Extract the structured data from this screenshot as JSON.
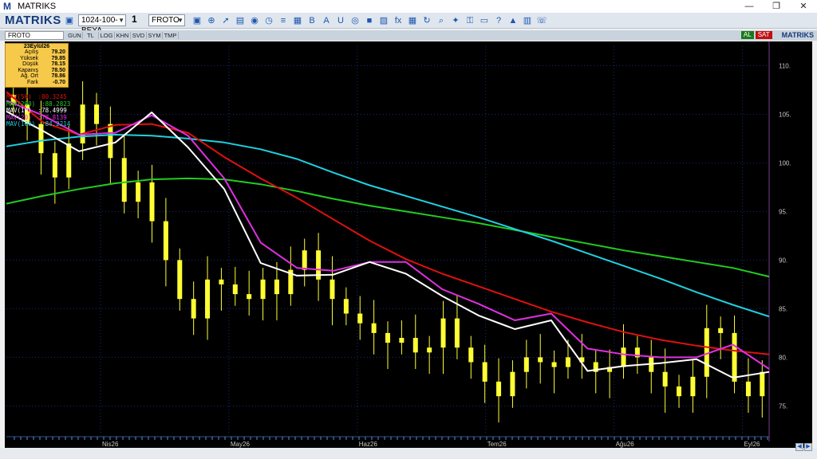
{
  "window": {
    "title": "MATRIKS",
    "min": "—",
    "max": "❐",
    "close": "✕"
  },
  "toolbar": {
    "brand": "MATRIKS",
    "layout_combo": "1024-100-BEYA",
    "layout_number": "1",
    "symbol_combo": "FROTO",
    "icons": [
      "save-icon",
      "zoom-icon",
      "cursor-icon",
      "chart-type-icon",
      "palette-icon",
      "clock-icon",
      "list-icon",
      "template-icon",
      "bold-icon",
      "font-color-icon",
      "underline-icon",
      "circle-icon",
      "stop-icon",
      "photo-icon",
      "fx-icon",
      "grid-icon",
      "refresh-icon",
      "search-icon",
      "twitter-icon",
      "lock-icon",
      "window-icon",
      "help-icon",
      "alert-icon",
      "calc-icon",
      "phone-icon"
    ]
  },
  "subbar": {
    "symbol": "FROTO",
    "timeframes": [
      "GUN",
      "TL",
      "LOG",
      "KHN",
      "SVD",
      "SYM",
      "TMP"
    ],
    "al": "AL",
    "sat": "SAT",
    "brand": "MATRIKS"
  },
  "info_box": {
    "date": "23Eylül26",
    "rows": [
      {
        "label": "Açılış",
        "value": "79.20"
      },
      {
        "label": "Yüksek",
        "value": "79.85"
      },
      {
        "label": "Düşük",
        "value": "78.15"
      },
      {
        "label": "Kapanış",
        "value": "78.50"
      },
      {
        "label": "Ağ. Ort",
        "value": "78.86"
      },
      {
        "label": "Fark",
        "value": "-0.70"
      }
    ]
  },
  "ma_legend": [
    {
      "label": "MAV(50)",
      "value": ":80.3245",
      "color": "#e01010"
    },
    {
      "label": "MAV(200)",
      "value": ":88.2823",
      "color": "#22cc22"
    },
    {
      "label": "MAV(10)",
      "value": ":78.4999",
      "color": "#ffffff"
    },
    {
      "label": "MAV(20)",
      "value": ":78.8139",
      "color": "#e030e0"
    },
    {
      "label": "MAV(100)",
      "value": ":84.2214",
      "color": "#20d0e0"
    }
  ],
  "colors": {
    "candle": "#ffff33",
    "bg": "#000000",
    "grid": "#1c2a7a"
  },
  "chart_data": {
    "type": "line",
    "y_ticks": [
      "110.",
      "105.",
      "100.",
      "95.",
      "90.",
      "85.",
      "80.",
      "75."
    ],
    "ylim": [
      72,
      112
    ],
    "x_ticks": [
      "Nis26",
      "May26",
      "Haz26",
      "Tem26",
      "Ağu26",
      "Eyl26"
    ],
    "series": [
      {
        "name": "MAV(200)",
        "color": "#22cc22",
        "values": [
          95.8,
          96.6,
          97.3,
          97.9,
          98.3,
          98.4,
          98.3,
          97.8,
          97.1,
          96.3,
          95.6,
          95.0,
          94.4,
          93.8,
          93.1,
          92.4,
          91.7,
          91.0,
          90.4,
          89.8,
          89.2,
          88.3
        ]
      },
      {
        "name": "MAV(100)",
        "color": "#20d0e0",
        "values": [
          101.7,
          102.3,
          102.7,
          102.9,
          102.8,
          102.5,
          102.1,
          101.4,
          100.4,
          99.0,
          97.7,
          96.6,
          95.5,
          94.4,
          93.2,
          92.0,
          90.7,
          89.4,
          88.1,
          86.7,
          85.4,
          84.2
        ]
      },
      {
        "name": "MAV(50)",
        "color": "#e01010",
        "values": [
          107.3,
          104.2,
          102.9,
          103.9,
          104.0,
          103.1,
          100.6,
          98.4,
          96.4,
          94.2,
          92.0,
          90.1,
          88.6,
          87.3,
          86.0,
          84.7,
          83.6,
          82.6,
          81.8,
          81.2,
          80.7,
          80.3
        ]
      },
      {
        "name": "MAV(20)",
        "color": "#e030e0",
        "values": [
          106.4,
          104.9,
          102.9,
          103.1,
          104.9,
          102.8,
          98.4,
          91.8,
          89.2,
          88.9,
          89.8,
          89.8,
          87.0,
          85.5,
          83.8,
          84.5,
          80.9,
          80.3,
          80.0,
          80.0,
          81.3,
          78.8
        ]
      },
      {
        "name": "MAV(10)",
        "color": "#ffffff",
        "values": [
          105.3,
          103.3,
          101.2,
          102.1,
          105.2,
          101.6,
          97.3,
          89.7,
          88.4,
          88.5,
          89.8,
          88.6,
          86.3,
          84.3,
          82.9,
          83.8,
          78.6,
          79.1,
          79.4,
          79.8,
          77.9,
          78.5
        ]
      }
    ],
    "candles_close": [
      106.0,
      104.0,
      101.0,
      98.5,
      102.0,
      106.0,
      104.0,
      100.5,
      96.0,
      98.0,
      94.0,
      90.0,
      86.0,
      84.0,
      88.0,
      87.5,
      86.5,
      86.0,
      88.0,
      86.5,
      89.0,
      91.0,
      88.0,
      86.0,
      84.5,
      83.5,
      82.5,
      81.5,
      82.0,
      80.5,
      81.0,
      84.0,
      81.0,
      79.5,
      77.5,
      76.0,
      78.5,
      80.0,
      79.5,
      79.0,
      80.0,
      79.5,
      78.5,
      79.0,
      81.0,
      80.0,
      78.5,
      77.0,
      76.0,
      78.0,
      83.0,
      82.5,
      77.5,
      76.0,
      78.5
    ]
  }
}
